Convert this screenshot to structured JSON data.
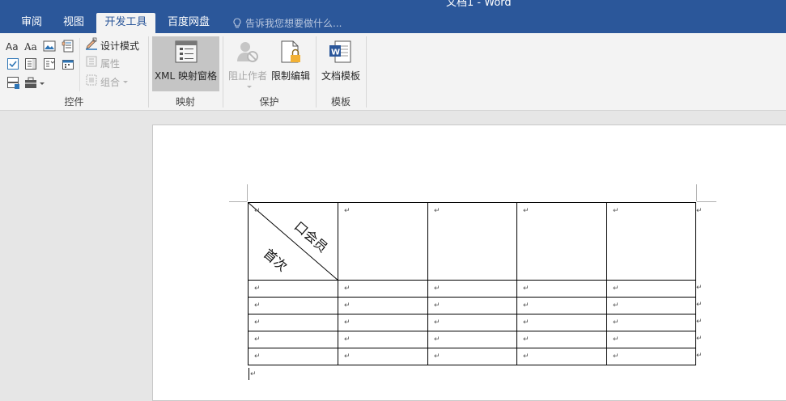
{
  "window": {
    "title": "文档1 - Word"
  },
  "tabs": [
    {
      "label": "审阅",
      "active": false
    },
    {
      "label": "视图",
      "active": false
    },
    {
      "label": "开发工具",
      "active": true
    },
    {
      "label": "百度网盘",
      "active": false
    }
  ],
  "tell_me": {
    "placeholder": "告诉我您想要做什么..."
  },
  "ribbon": {
    "controls": {
      "label": "控件",
      "design_mode": "设计模式",
      "properties": "属性",
      "group": "组合"
    },
    "mapping": {
      "label": "映射",
      "xml_pane": "XML 映射窗格"
    },
    "protect": {
      "label": "保护",
      "block_authors": "阻止作者",
      "restrict_editing": "限制编辑"
    },
    "templates": {
      "label": "模板",
      "document_template": "文档模板"
    }
  },
  "document": {
    "para_mark": "↵",
    "table": {
      "header_diagonal": {
        "top_right": "口会员",
        "bottom_left": "首次"
      },
      "columns": 5,
      "body_rows": 5
    }
  },
  "colors": {
    "title_bar": "#2b579a",
    "ribbon_bg": "#f3f3f3",
    "workspace": "#e6e6e6",
    "page": "#ffffff"
  },
  "icons": [
    "lightbulb-icon",
    "aa-rich-text-icon",
    "aa-plain-text-icon",
    "picture-content-icon",
    "building-block-icon",
    "checkbox-content-icon",
    "combo-box-icon",
    "dropdown-list-icon",
    "date-picker-icon",
    "repeating-section-icon",
    "legacy-tools-icon",
    "design-mode-icon",
    "properties-icon",
    "group-icon",
    "xml-mapping-icon",
    "block-authors-icon",
    "restrict-editing-icon",
    "document-template-icon"
  ]
}
